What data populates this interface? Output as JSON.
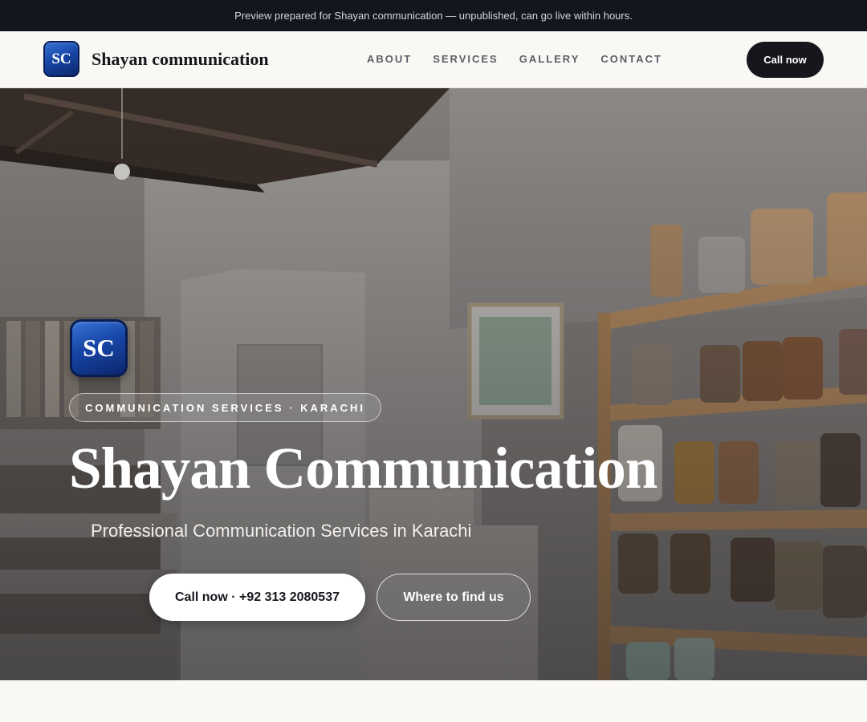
{
  "preview_banner": "Preview prepared for Shayan communication — unpublished, can go live within hours.",
  "header": {
    "logo_text": "SC",
    "brand_name": "Shayan communication",
    "nav": [
      "ABOUT",
      "SERVICES",
      "GALLERY",
      "CONTACT"
    ],
    "call_button": "Call now"
  },
  "hero": {
    "logo_text": "SC",
    "eyebrow": "COMMUNICATION SERVICES · KARACHI",
    "title": "Shayan Communication",
    "subtitle": "Professional Communication Services in Karachi",
    "primary_button": "Call now · +92 313 2080537",
    "secondary_button": "Where to find us",
    "background_image": "store-interior-photo"
  },
  "colors": {
    "dark": "#13161c",
    "page_bg": "#faf8f4",
    "logo_blue": "#1746a8"
  }
}
